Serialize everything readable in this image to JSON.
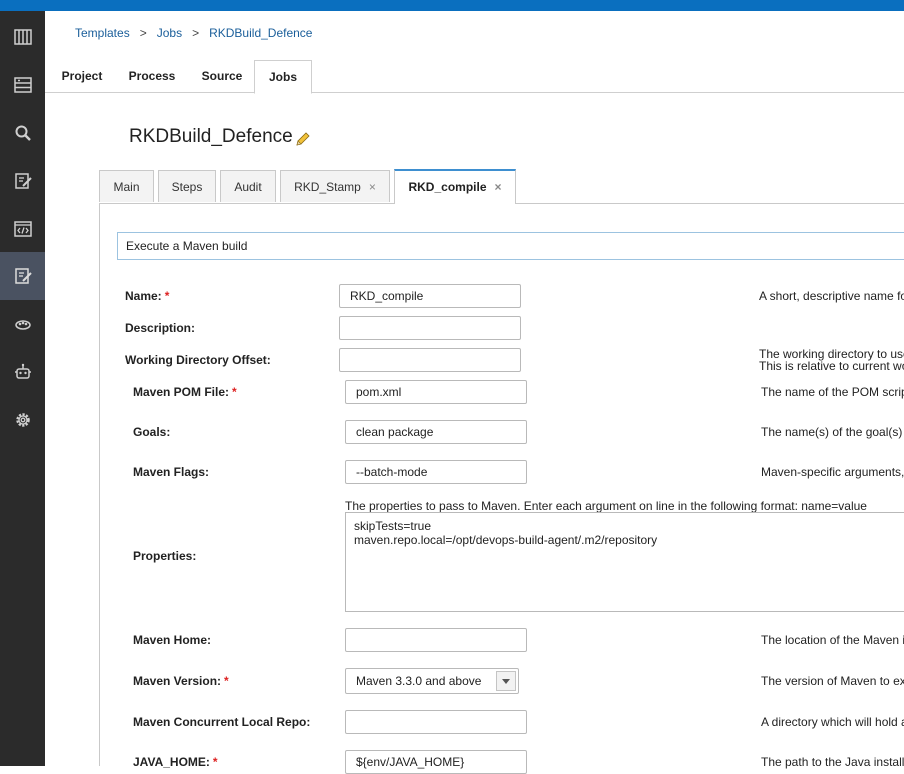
{
  "breadcrumb": {
    "items": [
      "Templates",
      "Jobs",
      "RKDBuild_Defence"
    ],
    "separator": ">"
  },
  "project_tabs": [
    "Project",
    "Process",
    "Source",
    "Jobs"
  ],
  "page_title": "RKDBuild_Defence",
  "sub_tabs": [
    {
      "label": "Main"
    },
    {
      "label": "Steps"
    },
    {
      "label": "Audit"
    },
    {
      "label": "RKD_Stamp",
      "close": "×"
    },
    {
      "label": "RKD_compile",
      "close": "×"
    }
  ],
  "step_description": "Execute a Maven build",
  "form": {
    "name": {
      "label": "Name:",
      "required": "*",
      "value": "RKD_compile",
      "help": "A short, descriptive name fo"
    },
    "description": {
      "label": "Description:",
      "value": ""
    },
    "working_directory": {
      "label": "Working Directory Offset:",
      "value": "",
      "help1": "The working directory to use",
      "help2": "This is relative to current wo"
    },
    "pom_file": {
      "label": "Maven POM File:",
      "required": "*",
      "value": "pom.xml",
      "help": "The name of the POM scrip"
    },
    "goals": {
      "label": "Goals:",
      "value": "clean package",
      "help": "The name(s) of the goal(s)"
    },
    "flags": {
      "label": "Maven Flags:",
      "value": "--batch-mode",
      "help": "Maven-specific arguments,"
    },
    "properties": {
      "label": "Properties:",
      "help": "The properties to pass to Maven. Enter each argument on line in the following format: name=value",
      "value": "skipTests=true\nmaven.repo.local=/opt/devops-build-agent/.m2/repository"
    },
    "maven_home": {
      "label": "Maven Home:",
      "value": "",
      "help": "The location of the Maven i"
    },
    "maven_version": {
      "label": "Maven Version:",
      "required": "*",
      "value": "Maven 3.3.0 and above",
      "help": "The version of Maven to ex"
    },
    "concurrent_repo": {
      "label": "Maven Concurrent Local Repo:",
      "value": "",
      "help": "A directory which will hold a"
    },
    "java_home": {
      "label": "JAVA_HOME:",
      "required": "*",
      "value": "${env/JAVA_HOME}",
      "help": "The path to the Java install"
    }
  },
  "sidebar_icons": [
    "dashboard-icon",
    "list-icon",
    "search-icon",
    "edit-document-icon",
    "code-icon",
    "template-edit-icon",
    "cloud-group-icon",
    "robot-agent-icon",
    "settings-gear-icon"
  ],
  "colors": {
    "topbar": "#0a6fbf",
    "sidebar": "#2b2b2b",
    "sidebar_active": "#4a5261",
    "link": "#1a5e9a",
    "required": "#dd2222"
  }
}
